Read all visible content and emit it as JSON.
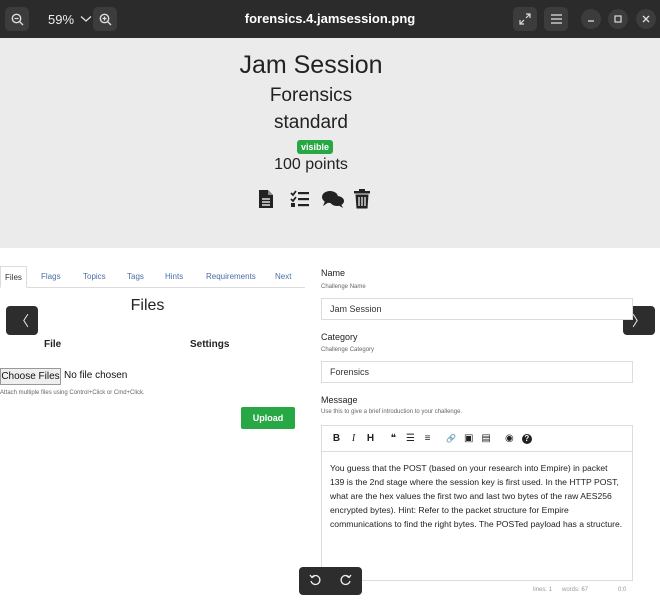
{
  "window": {
    "title": "forensics.4.jamsession.png",
    "zoom": "59%"
  },
  "challenge": {
    "name": "Jam Session",
    "category": "Forensics",
    "type": "standard",
    "state": "visible",
    "points": "100 points",
    "icons": [
      "file-icon",
      "checklist-icon",
      "comments-icon",
      "trash-icon"
    ]
  },
  "tabs": [
    "Files",
    "Flags",
    "Topics",
    "Tags",
    "Hints",
    "Requirements",
    "Next"
  ],
  "files_panel": {
    "heading": "Files",
    "col_file": "File",
    "col_settings": "Settings",
    "choose_button": "Choose Files",
    "no_file": "No file chosen",
    "hint": "Attach multiple files using Control+Click or Cmd+Click.",
    "upload_button": "Upload"
  },
  "form": {
    "name_label": "Name",
    "name_sub": "Challenge Name",
    "name_value": "Jam Session",
    "category_label": "Category",
    "category_sub": "Challenge Category",
    "category_value": "Forensics",
    "message_label": "Message",
    "message_sub": "Use this to give a brief introduction to your challenge.",
    "message_text": "You guess that the POST (based on your research into Empire) in packet 139 is the 2nd stage where the session key is first used.  In the HTTP POST, what are the hex values the first two and last two bytes of the raw AES256 encrypted bytes).  Hint: Refer to the packet structure for Empire communications to find the right bytes.  The POSTed payload has a structure.",
    "status_lines": "lines: 1",
    "status_words": "words: 67",
    "status_pos": "0:0"
  },
  "toolbar": {
    "bold": "B",
    "italic": "I",
    "heading": "H",
    "quote": "❝",
    "ul": "☰",
    "ol": "≡",
    "link": "🔗",
    "image": "▣",
    "file": "▤",
    "preview": "◉",
    "help": "?"
  },
  "nav": {
    "prev": "〈",
    "next": "〉"
  }
}
